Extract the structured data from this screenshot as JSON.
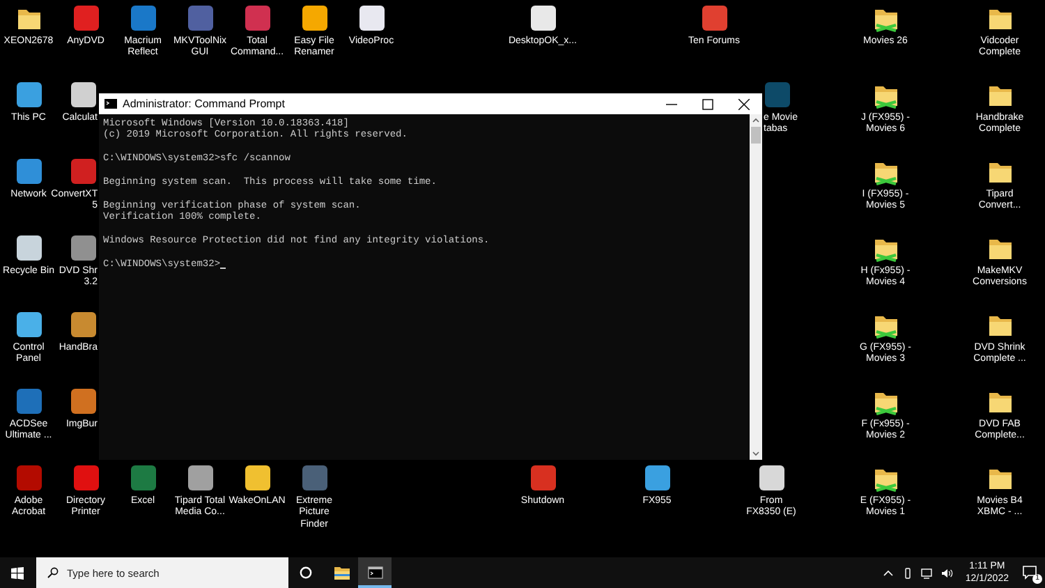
{
  "desktop": {
    "columns": [
      [
        {
          "label": "XEON2678",
          "kind": "folder"
        },
        {
          "label": "This PC",
          "kind": "app",
          "color": "#3aa0e0"
        },
        {
          "label": "Network",
          "kind": "app",
          "color": "#2f8fd8"
        },
        {
          "label": "Recycle Bin",
          "kind": "app",
          "color": "#c8d4dc"
        },
        {
          "label": "Control Panel",
          "kind": "app",
          "color": "#4ab0e8"
        },
        {
          "label": "ACDSee Ultimate ...",
          "kind": "app",
          "color": "#1e6fb8"
        },
        {
          "label": "Adobe Acrobat",
          "kind": "app",
          "color": "#b30b00"
        }
      ],
      [
        {
          "label": "AnyDVD",
          "kind": "app",
          "color": "#e02020"
        },
        {
          "label": "Calculat",
          "kind": "app",
          "color": "#d0d0d0"
        },
        {
          "label": "ConvertXT 5",
          "kind": "app",
          "color": "#d02020"
        },
        {
          "label": "DVD Shr 3.2",
          "kind": "app",
          "color": "#909090"
        },
        {
          "label": "HandBra",
          "kind": "app",
          "color": "#c88a30"
        },
        {
          "label": "ImgBur",
          "kind": "app",
          "color": "#d07020"
        },
        {
          "label": "Directory Printer",
          "kind": "app",
          "color": "#e01010"
        }
      ],
      [
        {
          "label": "Macrium Reflect",
          "kind": "app",
          "color": "#1a78c8"
        },
        null,
        null,
        null,
        null,
        null,
        {
          "label": "Excel",
          "kind": "app",
          "color": "#1d7a43"
        }
      ],
      [
        {
          "label": "MKVToolNix GUI",
          "kind": "app",
          "color": "#5060a0"
        },
        null,
        null,
        null,
        null,
        null,
        {
          "label": "Tipard Total Media Co...",
          "kind": "app",
          "color": "#a0a0a0"
        }
      ],
      [
        {
          "label": "Total Command...",
          "kind": "app",
          "color": "#d03050"
        },
        null,
        null,
        null,
        null,
        null,
        {
          "label": "WakeOnLAN",
          "kind": "app",
          "color": "#f0c030"
        }
      ],
      [
        {
          "label": "Easy File Renamer",
          "kind": "app",
          "color": "#f5a800"
        },
        null,
        null,
        null,
        null,
        null,
        {
          "label": "Extreme Picture Finder",
          "kind": "app",
          "color": "#4a6078"
        }
      ],
      [
        {
          "label": "VideoProc",
          "kind": "app",
          "color": "#e8e8f0"
        },
        null,
        null,
        null,
        null,
        null,
        null
      ],
      [
        null,
        null,
        null,
        null,
        null,
        null,
        null
      ],
      [
        null,
        null,
        null,
        null,
        null,
        null,
        null
      ],
      [
        {
          "label": "DesktopOK_x...",
          "kind": "app",
          "color": "#e8e8e8"
        },
        null,
        null,
        null,
        null,
        null,
        {
          "label": "Shutdown",
          "kind": "app",
          "color": "#d83020"
        }
      ],
      [
        null,
        null,
        null,
        null,
        null,
        null,
        null
      ],
      [
        null,
        null,
        null,
        null,
        null,
        null,
        {
          "label": "FX955",
          "kind": "app",
          "color": "#3aa0e0"
        }
      ],
      [
        {
          "label": "Ten Forums",
          "kind": "app",
          "color": "#e04030"
        },
        null,
        null,
        null,
        null,
        null,
        null
      ],
      [
        null,
        {
          "label": "e Movie tabas",
          "kind": "app",
          "color": "#0d4a68"
        },
        null,
        null,
        null,
        null,
        {
          "label": "From FX8350 (E)",
          "kind": "app",
          "color": "#d8d8d8"
        }
      ],
      [
        null,
        null,
        null,
        null,
        null,
        null,
        null
      ],
      [
        {
          "label": "Movies 26",
          "kind": "network-folder"
        },
        {
          "label": "J (FX955) - Movies 6",
          "kind": "network-folder"
        },
        {
          "label": "I (FX955) - Movies 5",
          "kind": "network-folder"
        },
        {
          "label": "H (Fx955) - Movies 4",
          "kind": "network-folder"
        },
        {
          "label": "G (FX955) - Movies 3",
          "kind": "network-folder"
        },
        {
          "label": "F (Fx955) - Movies 2",
          "kind": "network-folder"
        },
        {
          "label": "E (FX955) - Movies 1",
          "kind": "network-folder"
        }
      ],
      [
        null,
        null,
        null,
        null,
        null,
        null,
        null
      ],
      [
        {
          "label": "Vidcoder Complete",
          "kind": "folder"
        },
        {
          "label": "Handbrake Complete",
          "kind": "folder"
        },
        {
          "label": "Tipard Convert...",
          "kind": "folder"
        },
        {
          "label": "MakeMKV Conversions",
          "kind": "folder"
        },
        {
          "label": "DVD Shrink Complete ...",
          "kind": "folder"
        },
        {
          "label": "DVD FAB Complete...",
          "kind": "folder"
        },
        {
          "label": "Movies B4 XBMC - ...",
          "kind": "folder"
        }
      ]
    ]
  },
  "window": {
    "title": "Administrator: Command Prompt",
    "blocks": [
      [
        "Microsoft Windows [Version 10.0.18363.418]",
        "(c) 2019 Microsoft Corporation. All rights reserved."
      ],
      [
        "C:\\WINDOWS\\system32>sfc /scannow"
      ],
      [
        "Beginning system scan.  This process will take some time."
      ],
      [
        "Beginning verification phase of system scan.",
        "Verification 100% complete."
      ],
      [
        "Windows Resource Protection did not find any integrity violations."
      ],
      [
        "C:\\WINDOWS\\system32>"
      ]
    ]
  },
  "taskbar": {
    "search": {
      "placeholder": "Type here to search"
    },
    "apps": [
      {
        "kind": "explorer",
        "active": false
      },
      {
        "kind": "terminal",
        "active": true
      }
    ],
    "time": "1:11 PM",
    "date": "12/1/2022",
    "notifications": "1"
  }
}
